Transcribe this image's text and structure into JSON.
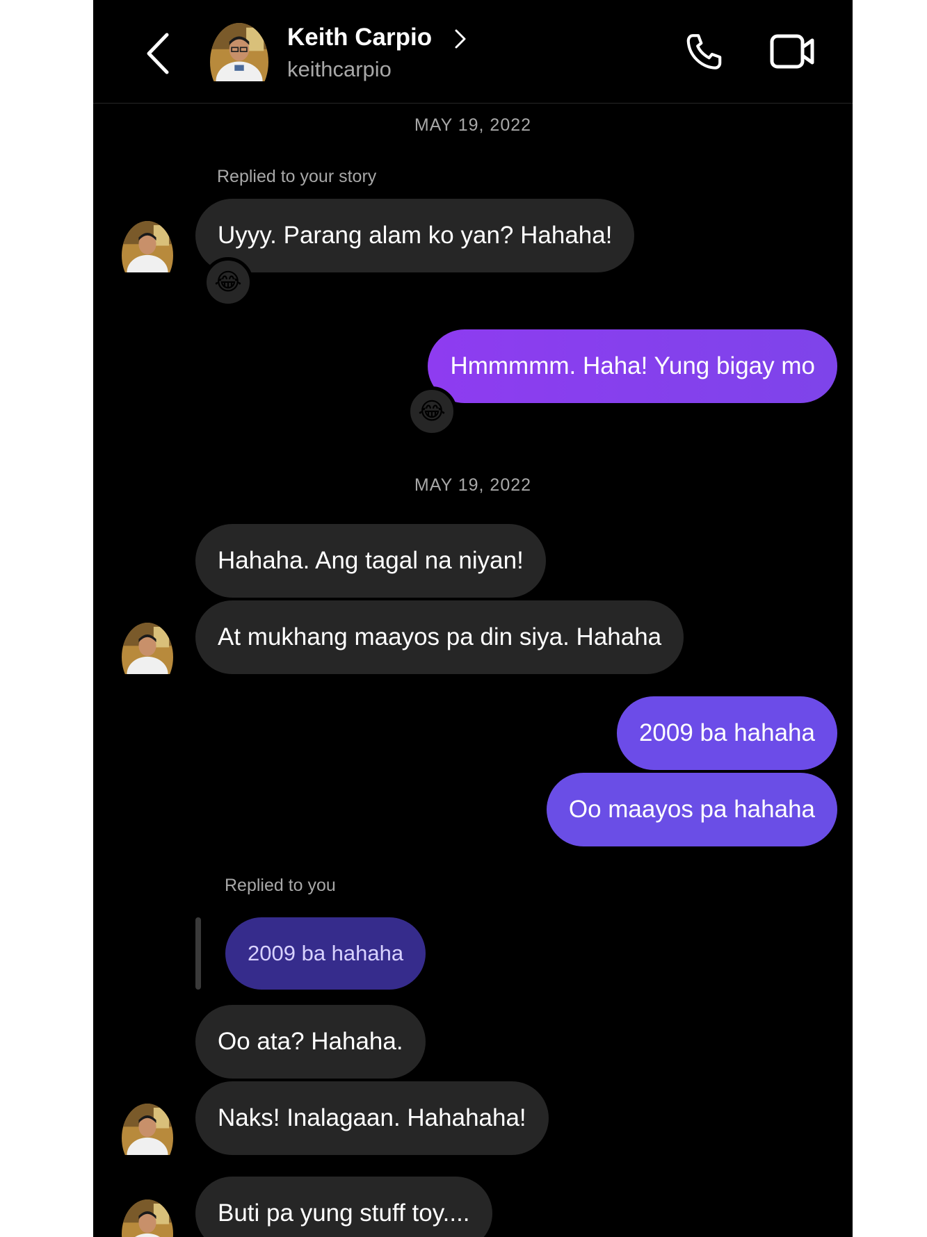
{
  "header": {
    "name": "Keith Carpio",
    "username": "keithcarpio",
    "back_icon": "chevron-left-icon",
    "call_icon": "phone-icon",
    "video_icon": "video-camera-icon"
  },
  "colors": {
    "background": "#000000",
    "incoming_bubble": "#262626",
    "outgoing_gradient_start": "#8e3cf0",
    "outgoing_gradient_end": "#6a4ce8",
    "quoted_bubble": "#362c8c"
  },
  "messages": {
    "date_1": "MAY 19, 2022",
    "story_reply_label": "Replied to your story",
    "m1": "Uyyy. Parang alam ko yan? Hahaha!",
    "m1_reaction": "😂",
    "m2": "Hmmmmm. Haha! Yung bigay mo",
    "m2_reaction": "😂",
    "date_2": "MAY 19, 2022",
    "m3": "Hahaha. Ang tagal na niyan!",
    "m4": "At mukhang maayos pa din siya. Hahaha",
    "m5": "2009 ba hahaha",
    "m6": "Oo maayos pa hahaha",
    "reply_label": "Replied to you",
    "quoted": "2009 ba hahaha",
    "m7": "Oo ata? Hahaha.",
    "m8": "Naks! Inalagaan. Hahahaha!",
    "m9": "Buti pa yung stuff toy...."
  }
}
